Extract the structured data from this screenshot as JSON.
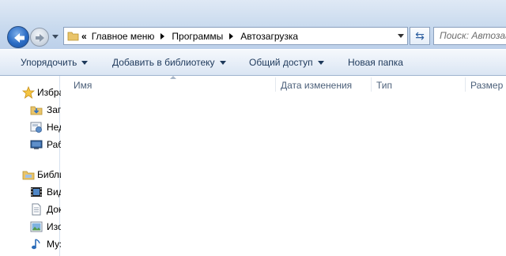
{
  "address": {
    "overflow_chevron": "«",
    "crumbs": [
      "Главное меню",
      "Программы",
      "Автозагрузка"
    ]
  },
  "search": {
    "placeholder": "Поиск: Автозагрузка"
  },
  "toolbar": {
    "organize": "Упорядочить",
    "add_to_library": "Добавить в библиотеку",
    "share": "Общий доступ",
    "new_folder": "Новая папка"
  },
  "nav": {
    "favorites": "Избранное",
    "downloads": "Загрузки",
    "recent": "Недавние места",
    "desktop": "Рабочий стол",
    "libraries": "Библиотеки",
    "videos": "Видео",
    "documents": "Документы",
    "pictures": "Изображения",
    "music": "Музыка"
  },
  "columns": {
    "name": "Имя",
    "modified": "Дата изменения",
    "type": "Тип",
    "size": "Размер"
  },
  "colors": {
    "accent": "#1e395b",
    "titlebar": "#c9daee",
    "back_button": "#2b6cc4"
  }
}
